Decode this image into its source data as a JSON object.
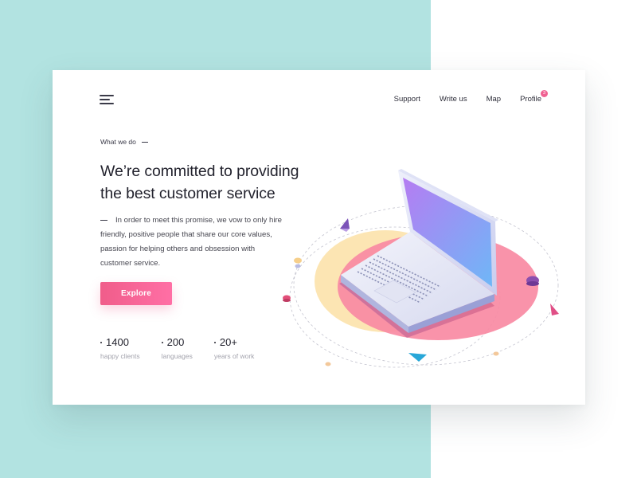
{
  "nav": {
    "items": [
      "Support",
      "Write us",
      "Map",
      "Profile"
    ],
    "profile_badge": "3"
  },
  "hero": {
    "eyebrow": "What we do",
    "headline_line1": "We’re committed to providing",
    "headline_line2": "the best customer service",
    "body": "In order to meet this promise, we vow to only hire friendly, positive people that share our core values, passion for helping others and obsession with customer service.",
    "cta_label": "Explore"
  },
  "stats": [
    {
      "value": "1400",
      "label": "happy clients"
    },
    {
      "value": "200",
      "label": "languages"
    },
    {
      "value": "20+",
      "label": "years of work"
    }
  ],
  "colors": {
    "left_background": "#b2e3e1",
    "accent_pink": "#f05d8a",
    "blob_yellow": "#fbe0a6",
    "blob_pink": "#f98aa3",
    "screen_gradient": [
      "#b57cf2",
      "#6fb7f7"
    ]
  },
  "icons": [
    "hamburger-menu-icon",
    "laptop-illustration"
  ]
}
